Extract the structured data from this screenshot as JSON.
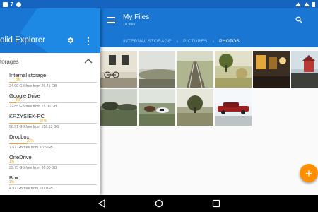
{
  "status_bar": {
    "left_icons": [
      "notification-square-icon",
      "number-7-icon",
      "photos-icon"
    ],
    "right_icons": [
      "wifi-icon",
      "signal-icon",
      "battery-icon"
    ],
    "color": "#1565c0"
  },
  "drawer": {
    "title": "olid Explorer",
    "settings_icon": "gear-icon",
    "menu_icon": "overflow-menu-icon",
    "section_label": "torages",
    "storages": [
      {
        "name": "Internal storage",
        "percent_label": "8%",
        "used_fraction": 0.08,
        "detail": "24.09 GB free from 26.41 GB"
      },
      {
        "name": "Google Drive",
        "percent_label": "8%",
        "used_fraction": 0.08,
        "detail": "22.85 GB free from 25.00 GB"
      },
      {
        "name": "KRZYSIEK-PC",
        "percent_label": "37%",
        "used_fraction": 0.37,
        "detail": "98.91 GB free from 158.13 GB"
      },
      {
        "name": "Dropbox",
        "percent_label": "21%",
        "used_fraction": 0.21,
        "detail": "7.67 GB free from 9.75 GB"
      },
      {
        "name": "OneDrive",
        "percent_label": "1%",
        "used_fraction": 0.01,
        "detail": "29.75 GB free from 30.00 GB"
      },
      {
        "name": "Box",
        "percent_label": "1%",
        "used_fraction": 0.01,
        "detail": "4.97 GB free from 5.00 GB"
      }
    ],
    "accent": "#f5a623"
  },
  "main": {
    "title": "My Files",
    "subtitle": "10 files",
    "breadcrumb": [
      "INTERNAL STORAGE",
      "PICTURES",
      "PHOTOS"
    ],
    "app_bar_color": "#1976d2",
    "fab_label": "+",
    "fab_color": "#ff8f00",
    "photos": [
      "photo-building-bicycle",
      "photo-foggy-field",
      "photo-railway-tracks",
      "photo-tree-hay-bale",
      "photo-dark-windows",
      "photo-beach-hut",
      "photo-trees-landscape",
      "photo-cows-field",
      "photo-tree-meadow",
      "photo-red-classic-car"
    ]
  },
  "nav_bar": {
    "buttons": [
      "back-icon",
      "home-icon",
      "recents-icon"
    ]
  }
}
